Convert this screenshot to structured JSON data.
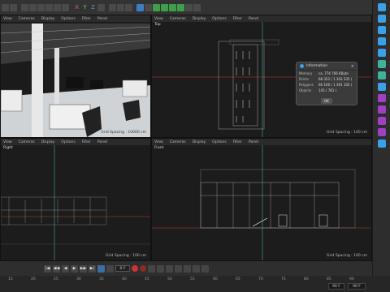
{
  "toolbar": {
    "axis_x": "X",
    "axis_y": "Y",
    "axis_z": "Z"
  },
  "viewports": {
    "perspective": {
      "menu": [
        "View",
        "Cameras",
        "Display",
        "Options",
        "Filter",
        "Panel"
      ],
      "spacing_label": "Grid Spacing : 10000 cm"
    },
    "top": {
      "menu": [
        "View",
        "Cameras",
        "Display",
        "Options",
        "Filter",
        "Panel"
      ],
      "name": "Top",
      "spacing_label": "Grid Spacing : 100 cm"
    },
    "right": {
      "menu": [
        "View",
        "Cameras",
        "Display",
        "Options",
        "Filter",
        "Panel"
      ],
      "name": "Right",
      "spacing_label": "Grid Spacing : 100 cm"
    },
    "front": {
      "menu": [
        "View",
        "Cameras",
        "Display",
        "Options",
        "Filter",
        "Panel"
      ],
      "name": "Front",
      "spacing_label": "Grid Spacing : 100 cm"
    }
  },
  "info_dialog": {
    "title": "Information",
    "close": "×",
    "rows": [
      {
        "key": "Memory",
        "value": "ca. 774 766 KByte"
      },
      {
        "key": "Points",
        "value": "68 322 ( 1 303 335 )"
      },
      {
        "key": "Polygons",
        "value": "66 166 ( 1 391 105 )"
      },
      {
        "key": "Objects",
        "value": "145 ( 781 )"
      }
    ],
    "ok_label": "OK"
  },
  "timeline": {
    "frame_value": "0 F",
    "buttons": [
      "|◀",
      "◀◀",
      "◀",
      "▶",
      "▶▶",
      "▶|"
    ]
  },
  "ruler": {
    "ticks": [
      "15",
      "20",
      "25",
      "30",
      "35",
      "40",
      "45",
      "50",
      "55",
      "60",
      "65",
      "70",
      "75",
      "80",
      "85",
      "90"
    ],
    "start_field": "90 F",
    "end_field": "90 F"
  },
  "colors": {
    "accent_blue": "#3aa0e8",
    "axis_green": "#3fb39a",
    "axis_red": "#c0392b"
  }
}
